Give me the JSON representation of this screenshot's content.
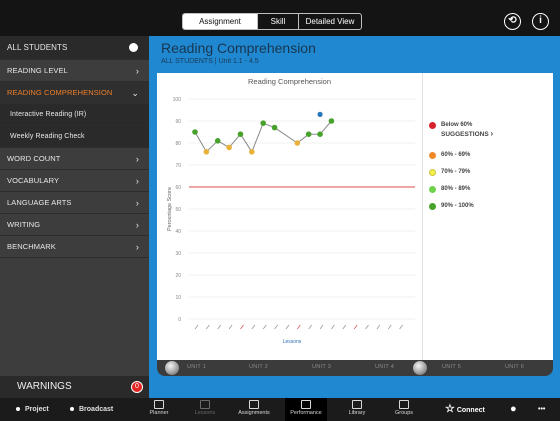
{
  "topbar": {
    "tabs": [
      "Assignment",
      "Skill",
      "Detailed View"
    ],
    "refresh_icon": "refresh-circle-icon",
    "info_icon": "info-circle-icon",
    "info_glyph": "i"
  },
  "sidebar": {
    "header": "ALL STUDENTS",
    "items": [
      {
        "label": "READING LEVEL"
      },
      {
        "label": "READING COMPREHENSION"
      },
      {
        "label": "Interactive Reading (IR)"
      },
      {
        "label": "Weekly Reading Check"
      },
      {
        "label": "WORD COUNT"
      },
      {
        "label": "VOCABULARY"
      },
      {
        "label": "LANGUAGE ARTS"
      },
      {
        "label": "WRITING"
      },
      {
        "label": "BENCHMARK"
      }
    ],
    "warnings_label": "WARNINGS",
    "warnings_count": "0"
  },
  "main": {
    "title": "Reading Comprehension",
    "subtitle": "ALL STUDENTS | Unit 1.1 - 4.5"
  },
  "legend": {
    "items": [
      {
        "label": "Below 60%",
        "color": "#d8202a"
      },
      {
        "label": "60% - 69%",
        "color": "#f0892a"
      },
      {
        "label": "70% - 79%",
        "color": "#f5f04a"
      },
      {
        "label": "80% - 89%",
        "color": "#6fd24a"
      },
      {
        "label": "90% - 100%",
        "color": "#47a22c"
      }
    ],
    "suggestions": "SUGGESTIONS"
  },
  "chart_data": {
    "type": "line",
    "title": "Reading Comprehension",
    "xlabel": "Lessons",
    "ylabel": "Percentage Score",
    "ylim": [
      0,
      100
    ],
    "yticks": [
      0,
      10,
      20,
      30,
      40,
      50,
      60,
      70,
      80,
      90,
      100
    ],
    "threshold": 60,
    "series": [
      {
        "values": [
          85,
          76,
          81,
          78,
          84,
          76,
          89,
          87,
          null,
          80,
          84,
          84,
          90
        ],
        "marker_colors": [
          "#47a22c",
          "#e8b23a",
          "#47a22c",
          "#e8b23a",
          "#47a22c",
          "#e8b23a",
          "#47a22c",
          "#47a22c",
          null,
          "#e8b23a",
          "#47a22c",
          "#47a22c",
          "#47a22c"
        ]
      }
    ],
    "extra_point": {
      "x_index": 11,
      "y": 93,
      "color": "#2a77b8"
    },
    "grid": true
  },
  "units": [
    "UNIT 1",
    "UNIT 2",
    "UNIT 3",
    "UNIT 4",
    "UNIT 5",
    "UNIT 6"
  ],
  "bottombar": {
    "project": "Project",
    "broadcast": "Broadcast",
    "tabs": [
      {
        "label": "Planner"
      },
      {
        "label": "Lessons"
      },
      {
        "label": "Assignments"
      },
      {
        "label": "Performance"
      },
      {
        "label": "Library"
      },
      {
        "label": "Groups"
      }
    ],
    "connect": "Connect",
    "more": "•••"
  }
}
